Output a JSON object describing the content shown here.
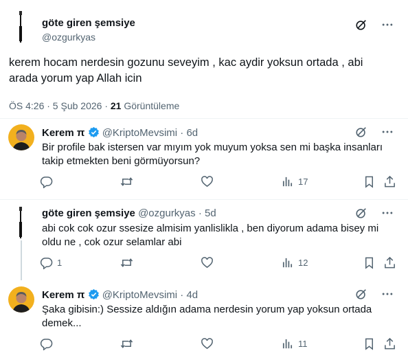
{
  "main": {
    "author_name": "göte giren şemsiye",
    "author_handle": "@ozgurkyas",
    "text": "kerem hocam nerdesin gozunu seveyim , kac aydir yoksun ortada , abi arada yorum yap Allah icin",
    "time": "ÖS 4:26 · 5 Şub 2026 ·",
    "views_count": "21",
    "views_label": "Görüntüleme"
  },
  "replies": [
    {
      "name": "Kerem",
      "name_suffix": "π",
      "handle": "@KriptoMevsimi",
      "age": "6d",
      "text": "Bir profile bak istersen var mıyım yok muyum yoksa sen mi başka insanları takip etmekten beni görmüyorsun?",
      "reply_count": "",
      "views": "17"
    },
    {
      "name": "göte giren şemsiye",
      "handle": "@ozgurkyas",
      "age": "5d",
      "text": "abi cok cok ozur ssesize almisim yanlislikla , ben diyorum adama bisey mi oldu ne , cok ozur selamlar abi",
      "reply_count": "1",
      "views": "12"
    },
    {
      "name": "Kerem",
      "name_suffix": "π",
      "handle": "@KriptoMevsimi",
      "age": "4d",
      "text": "Şaka gibisin:) Sessize aldığın adama nerdesin yorum yap yoksun ortada demek...",
      "reply_count": "",
      "views": "11"
    }
  ],
  "colors": {
    "text": "#0f1419",
    "secondary": "#536471",
    "verified": "#1d9bf0",
    "divider": "#eff3f4"
  }
}
